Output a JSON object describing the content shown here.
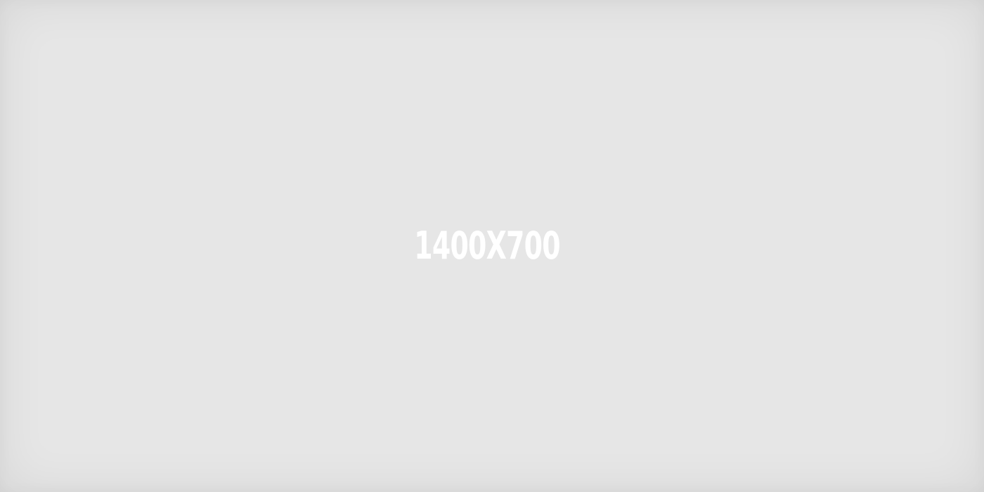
{
  "placeholder": {
    "label": "1400X700",
    "background_color": "#e6e6e6",
    "text_color": "#ffffff"
  }
}
